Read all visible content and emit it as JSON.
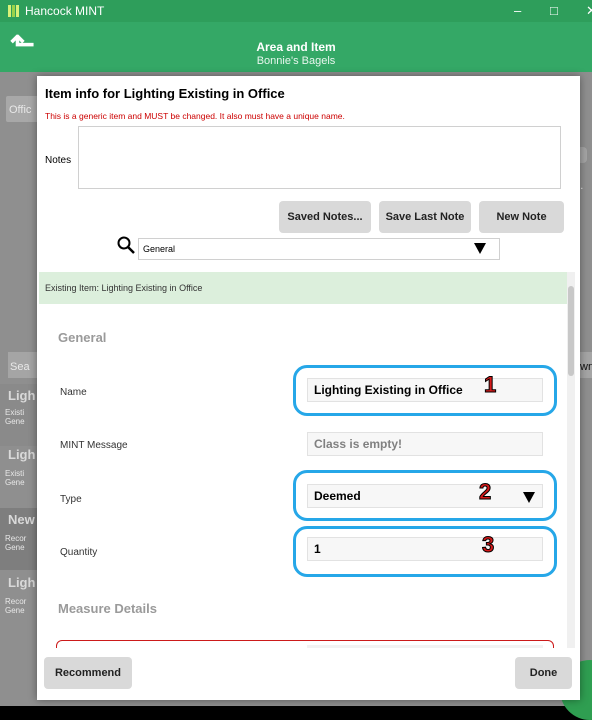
{
  "window": {
    "title": "Hancock MINT",
    "minimize": "–",
    "maximize": "□",
    "close": "✕"
  },
  "appbar": {
    "title": "Area and Item",
    "subtitle": "Bonnie's Bagels",
    "back_icon": "back-arrow-icon"
  },
  "background": {
    "tab_fragment": "Offic",
    "search_fragment": "Sea",
    "down_fragment": "wn",
    "more_fragment": "e...",
    "list": [
      {
        "title": "Ligh",
        "l1": "Existi",
        "l2": "Gene"
      },
      {
        "title": "Ligh",
        "l1": "Existi",
        "l2": "Gene"
      },
      {
        "title": "New",
        "l1": "Recor",
        "l2": "Gene"
      },
      {
        "title": "Ligh",
        "l1": "Recor",
        "l2": "Gene"
      }
    ]
  },
  "modal": {
    "title": "Item info for Lighting Existing in Office",
    "warning": "This is a generic item and MUST be changed. It also must have a unique name.",
    "notes_label": "Notes",
    "notes_value": "",
    "buttons": {
      "saved_notes": "Saved Notes...",
      "save_last_note": "Save Last Note",
      "new_note": "New Note"
    },
    "category_select": {
      "value": "General",
      "search_icon": "search-icon",
      "arrow_icon": "dropdown-arrow-icon"
    },
    "existing_item_banner": "Existing Item: Lighting Existing in Office",
    "sections": {
      "general": "General",
      "measure_details": "Measure Details"
    },
    "fields": {
      "name_label": "Name",
      "name_value": "Lighting Existing in Office",
      "mint_message_label": "MINT Message",
      "mint_message_value": "Class is empty!",
      "type_label": "Type",
      "type_value": "Deemed",
      "quantity_label": "Quantity",
      "quantity_value": "1"
    },
    "callouts": [
      "1",
      "2",
      "3"
    ],
    "footer": {
      "recommend": "Recommend",
      "done": "Done"
    }
  },
  "colors": {
    "titlebar": "#2e9e5b",
    "appbar": "#34a866",
    "warning": "#cc0000",
    "banner": "#dcefdc",
    "callout": "#26a7e8"
  }
}
